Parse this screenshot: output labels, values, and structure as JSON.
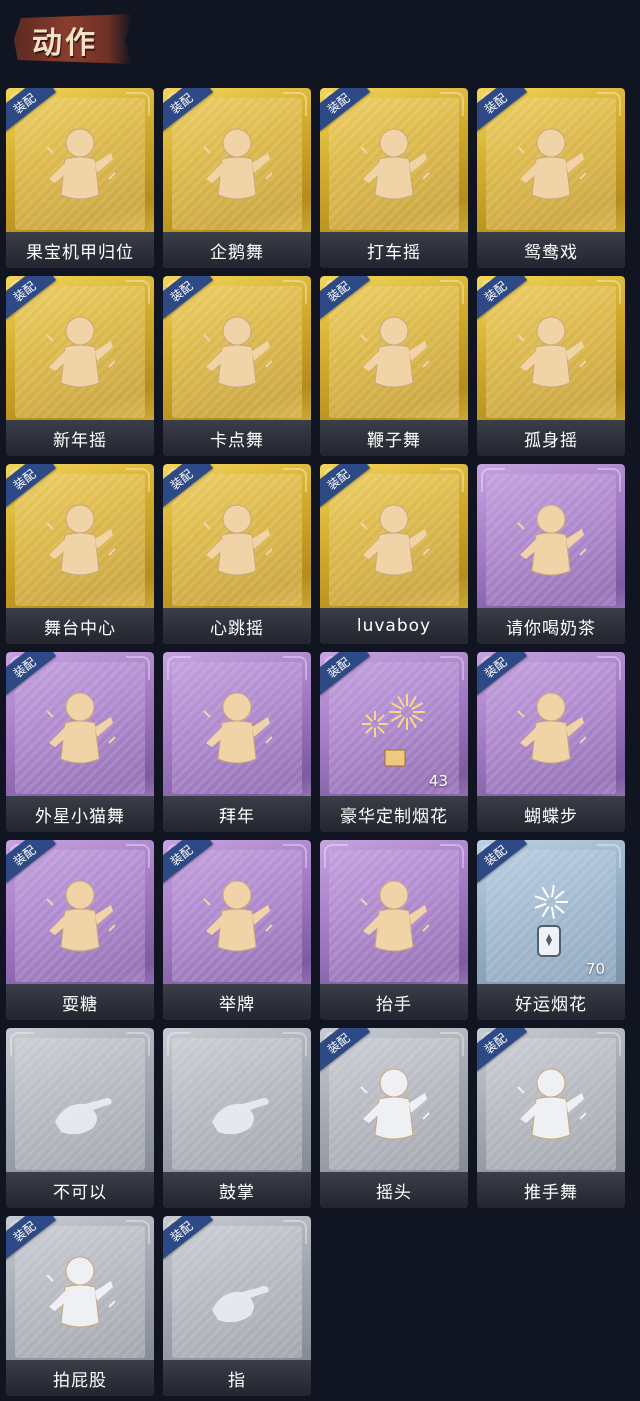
{
  "header": {
    "title": "动作"
  },
  "equip_tag": "装配",
  "colors": {
    "gold": "#d3ad2e",
    "purple": "#a37bc4",
    "blue": "#94adc4",
    "gray": "#a1a6ae",
    "equip_badge": "#2e4a86",
    "background": "#111522"
  },
  "cards": [
    {
      "label": "果宝机甲归位",
      "tier": "gold",
      "equipped": true,
      "icon": "character-dance-icon"
    },
    {
      "label": "企鹅舞",
      "tier": "gold",
      "equipped": true,
      "icon": "character-dance-icon"
    },
    {
      "label": "打车摇",
      "tier": "gold",
      "equipped": true,
      "icon": "character-dance-icon"
    },
    {
      "label": "鸳鸯戏",
      "tier": "gold",
      "equipped": true,
      "icon": "character-dance-icon"
    },
    {
      "label": "新年摇",
      "tier": "gold",
      "equipped": true,
      "icon": "character-dance-icon"
    },
    {
      "label": "卡点舞",
      "tier": "gold",
      "equipped": true,
      "icon": "character-dance-icon"
    },
    {
      "label": "鞭子舞",
      "tier": "gold",
      "equipped": true,
      "icon": "character-dance-icon"
    },
    {
      "label": "孤身摇",
      "tier": "gold",
      "equipped": true,
      "icon": "character-dance-icon"
    },
    {
      "label": "舞台中心",
      "tier": "gold",
      "equipped": true,
      "icon": "character-dance-icon"
    },
    {
      "label": "心跳摇",
      "tier": "gold",
      "equipped": true,
      "icon": "character-dance-icon"
    },
    {
      "label": "luvaboy",
      "tier": "gold",
      "equipped": true,
      "icon": "character-dance-icon"
    },
    {
      "label": "请你喝奶茶",
      "tier": "purple",
      "equipped": false,
      "icon": "character-sign-icon"
    },
    {
      "label": "外星小猫舞",
      "tier": "purple",
      "equipped": true,
      "icon": "character-dance-icon"
    },
    {
      "label": "拜年",
      "tier": "purple",
      "equipped": false,
      "icon": "character-bow-icon"
    },
    {
      "label": "豪华定制烟花",
      "tier": "purple",
      "equipped": true,
      "icon": "fireworks-icon",
      "count": "43"
    },
    {
      "label": "蝴蝶步",
      "tier": "purple",
      "equipped": true,
      "icon": "character-point-icon"
    },
    {
      "label": "耍糖",
      "tier": "purple",
      "equipped": true,
      "icon": "character-wave-icon"
    },
    {
      "label": "举牌",
      "tier": "purple",
      "equipped": true,
      "icon": "character-sign-icon"
    },
    {
      "label": "抬手",
      "tier": "purple",
      "equipped": false,
      "icon": "character-wave-icon"
    },
    {
      "label": "好运烟花",
      "tier": "blue",
      "equipped": true,
      "icon": "firework-can-icon",
      "count": "70"
    },
    {
      "label": "不可以",
      "tier": "gray",
      "equipped": false,
      "icon": "finger-wag-icon"
    },
    {
      "label": "鼓掌",
      "tier": "gray",
      "equipped": false,
      "icon": "clap-icon"
    },
    {
      "label": "摇头",
      "tier": "gray",
      "equipped": true,
      "icon": "character-shake-icon"
    },
    {
      "label": "推手舞",
      "tier": "gray",
      "equipped": true,
      "icon": "character-push-icon"
    },
    {
      "label": "拍屁股",
      "tier": "gray",
      "equipped": true,
      "icon": "character-bend-icon"
    },
    {
      "label": "指",
      "tier": "gray",
      "equipped": true,
      "icon": "pointing-hand-icon"
    }
  ]
}
